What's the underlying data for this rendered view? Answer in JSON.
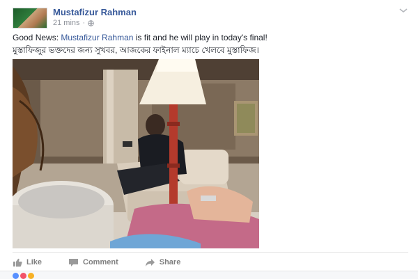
{
  "post": {
    "author": "Mustafizur Rahman",
    "timestamp": "21 mins",
    "text_en_prefix": "Good News: ",
    "text_en_link": "Mustafizur Rahman",
    "text_en_suffix": " is fit and he will play in today's final!",
    "text_bn": "মুস্তাফিজুর ভক্তদের জন্য সুখবর, আজকের ফাইনাল ম্যাচে খেলবে মুস্তাফিজ।"
  },
  "actions": {
    "like": "Like",
    "comment": "Comment",
    "share": "Share"
  },
  "colors": {
    "link": "#365899",
    "meta": "#90949c",
    "action": "#7f7f7f"
  },
  "icons": {
    "menu": "chevron-down-icon",
    "privacy": "globe-icon",
    "like": "thumbs-up-icon",
    "comment": "comment-icon",
    "share": "share-arrow-icon"
  }
}
